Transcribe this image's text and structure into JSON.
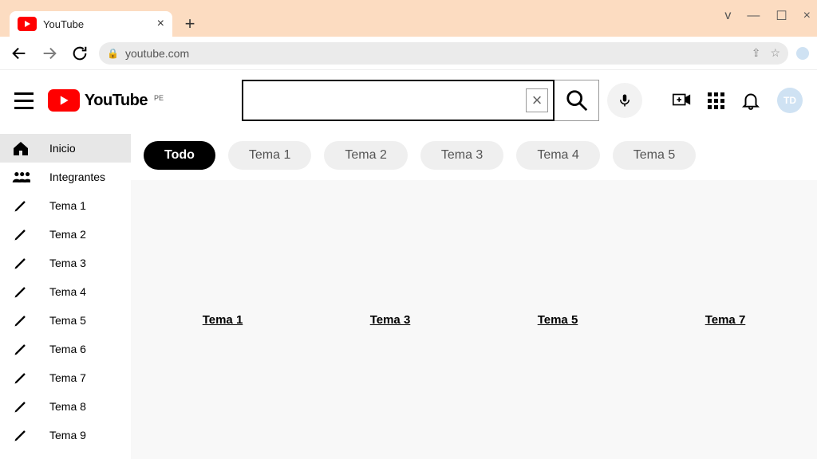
{
  "browser": {
    "tab_title": "YouTube",
    "url": "youtube.com",
    "window_letter": "v"
  },
  "header": {
    "logo_text": "YouTube",
    "country_code": "PE",
    "search_value": "",
    "avatar_initials": "TD"
  },
  "sidebar": {
    "items": [
      {
        "label": "Inicio",
        "icon": "home",
        "active": true
      },
      {
        "label": "Integrantes",
        "icon": "people",
        "active": false
      },
      {
        "label": "Tema 1",
        "icon": "pencil",
        "active": false
      },
      {
        "label": "Tema 2",
        "icon": "pencil",
        "active": false
      },
      {
        "label": "Tema 3",
        "icon": "pencil",
        "active": false
      },
      {
        "label": "Tema 4",
        "icon": "pencil",
        "active": false
      },
      {
        "label": "Tema 5",
        "icon": "pencil",
        "active": false
      },
      {
        "label": "Tema 6",
        "icon": "pencil",
        "active": false
      },
      {
        "label": "Tema 7",
        "icon": "pencil",
        "active": false
      },
      {
        "label": "Tema 8",
        "icon": "pencil",
        "active": false
      },
      {
        "label": "Tema 9",
        "icon": "pencil",
        "active": false
      }
    ]
  },
  "chips": [
    {
      "label": "Todo",
      "active": true
    },
    {
      "label": "Tema 1",
      "active": false
    },
    {
      "label": "Tema 2",
      "active": false
    },
    {
      "label": "Tema 3",
      "active": false
    },
    {
      "label": "Tema 4",
      "active": false
    },
    {
      "label": "Tema 5",
      "active": false
    }
  ],
  "feed": [
    {
      "title": "Tema 1"
    },
    {
      "title": "Tema 3"
    },
    {
      "title": "Tema 5"
    },
    {
      "title": "Tema 7"
    }
  ]
}
